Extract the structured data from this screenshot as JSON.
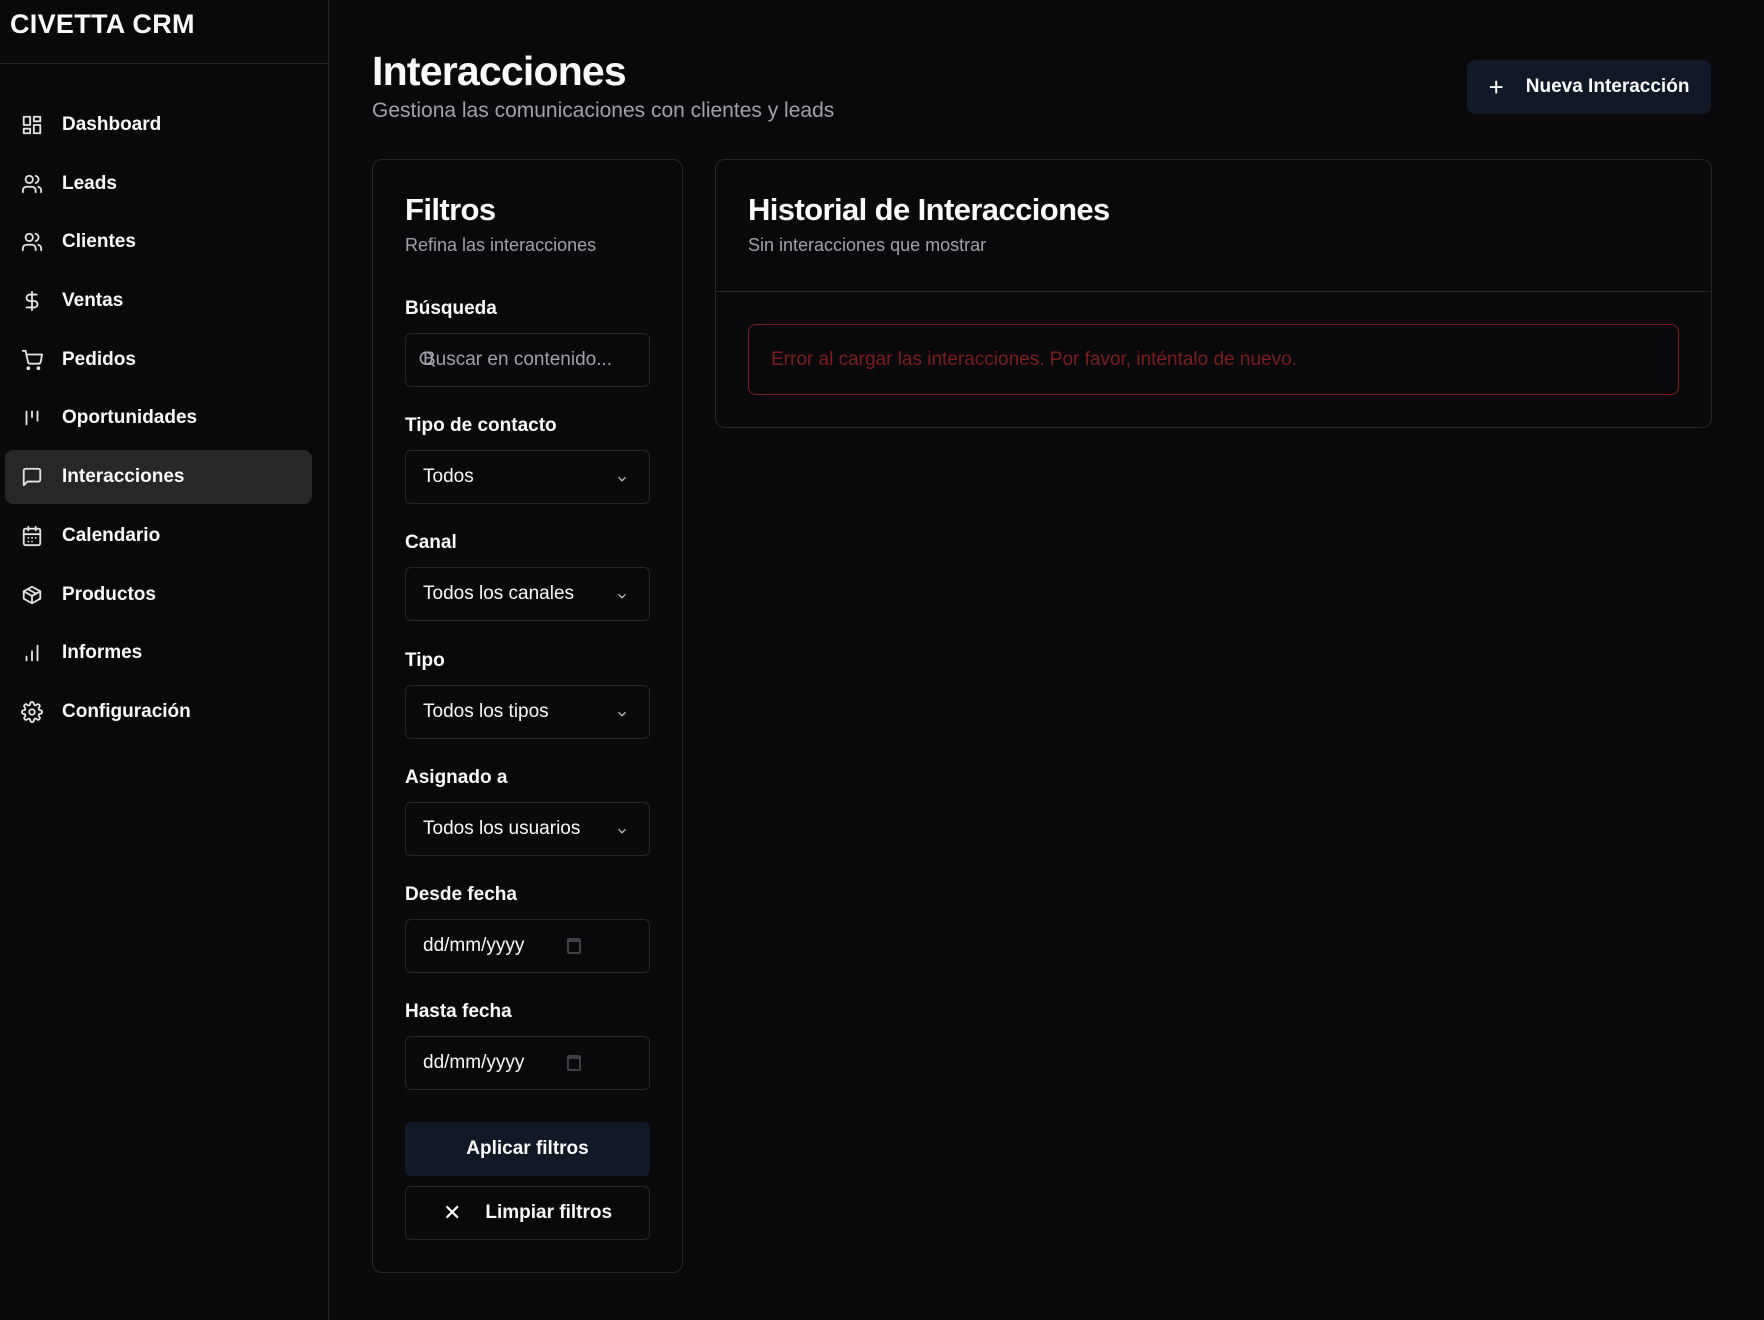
{
  "app": {
    "brand": "CIVETTA CRM"
  },
  "sidebar": {
    "items": [
      {
        "label": "Dashboard",
        "icon": "dashboard-icon"
      },
      {
        "label": "Leads",
        "icon": "users-icon"
      },
      {
        "label": "Clientes",
        "icon": "users-icon"
      },
      {
        "label": "Ventas",
        "icon": "dollar-icon"
      },
      {
        "label": "Pedidos",
        "icon": "cart-icon"
      },
      {
        "label": "Oportunidades",
        "icon": "kanban-icon"
      },
      {
        "label": "Interacciones",
        "icon": "message-icon",
        "active": true
      },
      {
        "label": "Calendario",
        "icon": "calendar-icon"
      },
      {
        "label": "Productos",
        "icon": "package-icon"
      },
      {
        "label": "Informes",
        "icon": "bar-chart-icon"
      },
      {
        "label": "Configuración",
        "icon": "gear-icon"
      }
    ]
  },
  "header": {
    "title": "Interacciones",
    "subtitle": "Gestiona las comunicaciones con clientes y leads",
    "new_button": "Nueva Interacción"
  },
  "filters": {
    "title": "Filtros",
    "description": "Refina las interacciones",
    "search_label": "Búsqueda",
    "search_placeholder": "Buscar en contenido...",
    "contact_type_label": "Tipo de contacto",
    "contact_type_value": "Todos",
    "channel_label": "Canal",
    "channel_value": "Todos los canales",
    "type_label": "Tipo",
    "type_value": "Todos los tipos",
    "assigned_label": "Asignado a",
    "assigned_value": "Todos los usuarios",
    "from_date_label": "Desde fecha",
    "from_date_value": "dd/mm/yyyy",
    "to_date_label": "Hasta fecha",
    "to_date_value": "dd/mm/yyyy",
    "apply_button": "Aplicar filtros",
    "clear_button": "Limpiar filtros"
  },
  "history": {
    "title": "Historial de Interacciones",
    "description": "Sin interacciones que mostrar",
    "error": "Error al cargar las interacciones. Por favor, inténtalo de nuevo."
  },
  "colors": {
    "background": "#09090b",
    "border": "#27272a",
    "primary_button": "#111827",
    "error": "#7f1d1d",
    "muted_text": "#a1a1aa"
  }
}
